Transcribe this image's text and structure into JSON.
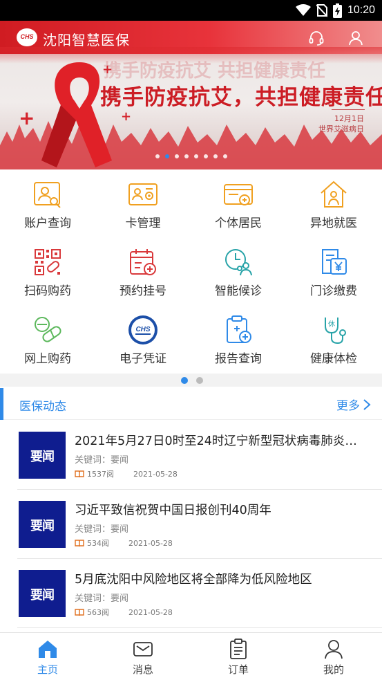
{
  "status_bar": {
    "time": "10:20",
    "icons": [
      "wifi-icon",
      "no-sim-icon",
      "battery-charging-icon"
    ]
  },
  "app": {
    "title": "沈阳智慧医保",
    "logo_text": "CHS"
  },
  "banner": {
    "headline": "携手防疫抗艾，共担健康责任",
    "date_line1": "12月1日",
    "date_line2": "世界艾滋病日",
    "slide_count": 8,
    "active_slide": 1
  },
  "services": [
    {
      "label": "账户查询",
      "icon": "account-search-icon"
    },
    {
      "label": "卡管理",
      "icon": "card-manage-icon"
    },
    {
      "label": "个体居民",
      "icon": "resident-card-icon"
    },
    {
      "label": "异地就医",
      "icon": "house-person-icon"
    },
    {
      "label": "扫码购药",
      "icon": "qr-medicine-icon"
    },
    {
      "label": "预约挂号",
      "icon": "calendar-add-icon"
    },
    {
      "label": "智能候诊",
      "icon": "clock-people-icon"
    },
    {
      "label": "门诊缴费",
      "icon": "payment-yuan-icon"
    },
    {
      "label": "网上购药",
      "icon": "pill-icon"
    },
    {
      "label": "电子凭证",
      "icon": "chs-badge-icon",
      "badge_text": "CHS"
    },
    {
      "label": "报告查询",
      "icon": "clipboard-plus-icon"
    },
    {
      "label": "健康体检",
      "icon": "stethoscope-icon"
    }
  ],
  "grid_pages": {
    "count": 2,
    "active": 0
  },
  "news": {
    "section_title": "医保动态",
    "more_label": "更多",
    "items": [
      {
        "title": "2021年5月27日0时至24时辽宁新型冠状病毒肺炎…",
        "thumb": "要闻",
        "keywords": "关键词：要闻",
        "reads": "1537阅",
        "date": "2021-05-28"
      },
      {
        "title": "习近平致信祝贺中国日报创刊40周年",
        "thumb": "要闻",
        "keywords": "关键词：要闻",
        "reads": "534阅",
        "date": "2021-05-28"
      },
      {
        "title": "5月底沈阳中风险地区将全部降为低风险地区",
        "thumb": "要闻",
        "keywords": "关键词：要闻",
        "reads": "563阅",
        "date": "2021-05-28"
      }
    ]
  },
  "bottom_nav": [
    {
      "label": "主页",
      "icon": "home-icon",
      "active": true
    },
    {
      "label": "消息",
      "icon": "message-icon",
      "active": false
    },
    {
      "label": "订单",
      "icon": "order-icon",
      "active": false
    },
    {
      "label": "我的",
      "icon": "profile-icon",
      "active": false
    }
  ],
  "colors": {
    "accent": "#2f8ae8",
    "brand_red": "#d01c22",
    "icon_orange": "#f0a020",
    "icon_red": "#d9393b",
    "icon_green": "#5cb85c",
    "icon_teal": "#27a3a8",
    "thumb_navy": "#0f1d8f"
  }
}
